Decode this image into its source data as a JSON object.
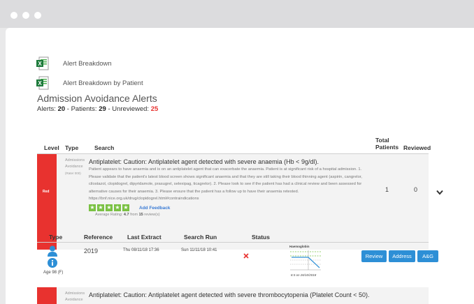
{
  "files": [
    {
      "label": "Alert Breakdown",
      "icon": "excel-icon"
    },
    {
      "label": "Alert Breakdown by Patient",
      "icon": "excel-icon"
    }
  ],
  "section_title": "Admission Avoidance Alerts",
  "summary": {
    "alerts_label": "Alerts:",
    "alerts": "20",
    "patients_label": "- Patients:",
    "patients": "29",
    "unreviewed_label": "- Unreviewed:",
    "unreviewed": "25"
  },
  "table_headers": {
    "level": "Level",
    "type": "Type",
    "search": "Search",
    "total_patients_1": "Total",
    "total_patients_2": "Patients",
    "reviewed": "Reviewed"
  },
  "alerts": [
    {
      "level": "Red",
      "type_line1": "Admissions",
      "type_line2": "Avoidance",
      "type_line3": "(Rater 000)",
      "title": "Antiplatelet: Caution: Antiplatelet agent detected with severe anaemia (Hb < 9g/dl).",
      "description": "Patient appears to have anaemia and is on an antiplatelet agent that can exacerbate the anaemia. Patient is at significant risk of a hospital admission. 1. Please validate that the patient's latest blood screen shows significant anaemia and that they are still taking their blood thinning agent (aspirin, cangrelor, cilostazol, clopidogrel, dipyridamole, prasugrel, selexipag, ticagrelor). 2. Please look to see if the patient has had a clinical review and been assessed for alternative causes for their anaemia. 3. Please ensure that the patient has a follow up to have their anaemia retested. https://bnf.nice.org.uk/drug/clopidogrel.html#contraindications",
      "add_feedback": "Add Feedback",
      "rating_prefix": "Average Rating:",
      "rating_value": "4.7",
      "rating_from": "from",
      "rating_count": "15",
      "rating_suffix": "review(s)",
      "total_patients": "1",
      "reviewed": "0"
    },
    {
      "type_line1": "Admissions",
      "type_line2": "Avoidance",
      "title": "Antiplatelet: Caution: Antiplatelet agent detected with severe thrombocytopenia (Platelet Count < 50)."
    }
  ],
  "patient_headers": {
    "type": "Type",
    "reference": "Reference",
    "last_extract": "Last Extract",
    "search_run": "Search Run",
    "status": "Status"
  },
  "patient_row": {
    "age": "Age 98 (F)",
    "reference": "2019",
    "last_extract": "Thu 08/11/18 17:36",
    "search_run": "Sun 11/11/18 10:41",
    "status_icon": "cross-icon",
    "chart_title": "Haemoglobin",
    "chart_caption": "8.5 on 26/10/2018",
    "buttons": [
      "Review",
      "Address",
      "A&G"
    ]
  },
  "colors": {
    "red": "#e8322f",
    "green": "#7ac143",
    "blue": "#2d8fd6",
    "link": "#3a7bd5"
  }
}
